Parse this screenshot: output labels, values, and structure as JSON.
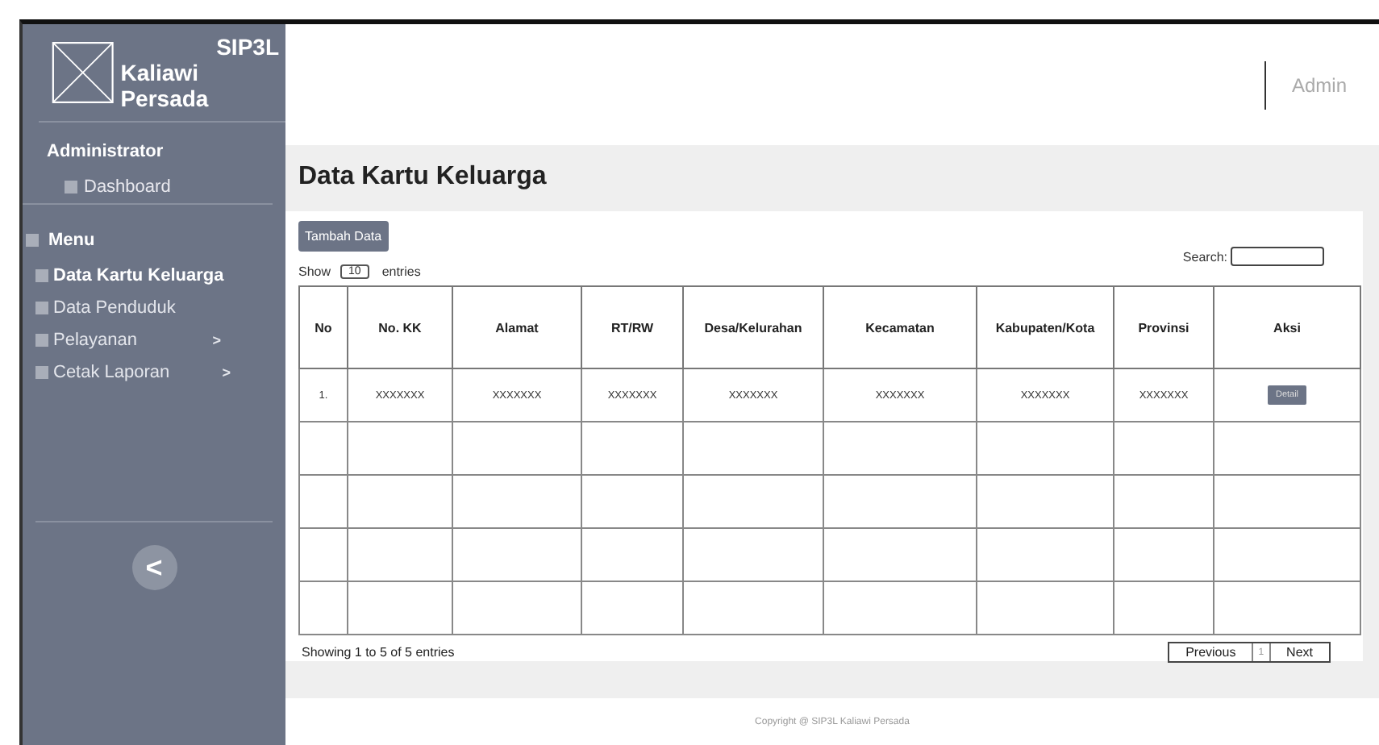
{
  "brand": {
    "title": "SIP3L",
    "subtitle": "Kaliawi Persada"
  },
  "sidebar": {
    "role": "Administrator",
    "dashboard": "Dashboard",
    "menu_heading": "Menu",
    "items": [
      {
        "label": "Data Kartu Keluarga",
        "selected": true
      },
      {
        "label": "Data Penduduk",
        "selected": false
      },
      {
        "label": "Pelayanan",
        "selected": false,
        "arrow": ">"
      },
      {
        "label": "Cetak Laporan",
        "selected": false,
        "arrow": ">"
      }
    ],
    "collapse": "<"
  },
  "header": {
    "user": "Admin"
  },
  "page_title": "Data Kartu Keluarga",
  "add_button": "Tambah Data",
  "length": {
    "show": "Show",
    "value": "10",
    "entries": "entries"
  },
  "search_label": "Search:",
  "table": {
    "columns": [
      "No",
      "No. KK",
      "Alamat",
      "RT/RW",
      "Desa/Kelurahan",
      "Kecamatan",
      "Kabupaten/Kota",
      "Provinsi",
      "Aksi"
    ],
    "rows": [
      {
        "kind": "data",
        "cells": [
          "1.",
          "XXXXXXX",
          "XXXXXXX",
          "XXXXXXX",
          "XXXXXXX",
          "XXXXXXX",
          "XXXXXXX",
          "XXXXXXX"
        ],
        "action": "Detail"
      },
      {
        "kind": "blank"
      },
      {
        "kind": "blank"
      },
      {
        "kind": "blank"
      },
      {
        "kind": "blank"
      }
    ]
  },
  "info": "Showing 1 to 5 of 5 entries",
  "pagination": [
    {
      "label": "Previous",
      "selected": false
    },
    {
      "label": "1",
      "selected": true
    },
    {
      "label": "Next",
      "selected": false
    }
  ],
  "footer": "Copyright @ SIP3L Kaliawi Persada"
}
